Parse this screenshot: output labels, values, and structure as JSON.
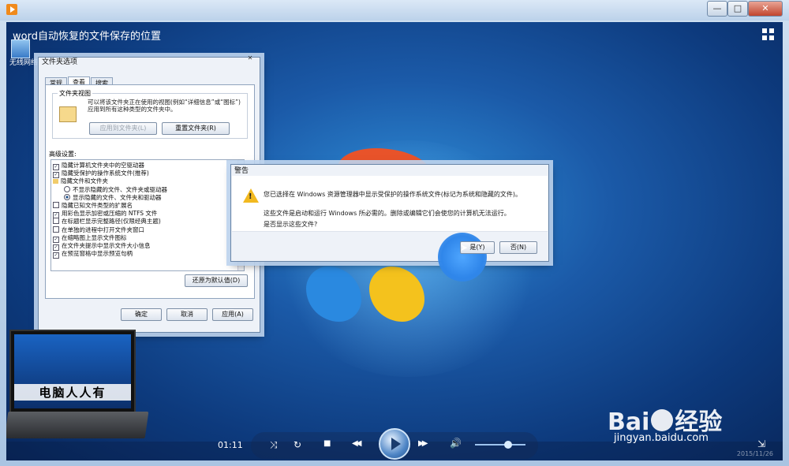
{
  "window": {
    "minimize": "—",
    "maximize": "□",
    "close": "✕"
  },
  "video": {
    "title": "word自动恢复的文件保存的位置",
    "desktop_icon_label": "无线网络"
  },
  "folder_options": {
    "title": "文件夹选项",
    "tabs": [
      "常规",
      "查看",
      "搜索"
    ],
    "folder_view_title": "文件夹视图",
    "folder_view_desc": "可以将该文件夹正在使用的视图(例如“详细信息”或“图标”)应用到所有这种类型的文件夹中。",
    "apply_to_folders": "应用到文件夹(L)",
    "reset_folders": "重置文件夹(R)",
    "advanced_label": "高级设置:",
    "advanced_items": [
      {
        "kind": "check",
        "checked": true,
        "text": "隐藏计算机文件夹中的空驱动器"
      },
      {
        "kind": "check",
        "checked": true,
        "text": "隐藏受保护的操作系统文件(推荐)"
      },
      {
        "kind": "folder",
        "text": "隐藏文件和文件夹"
      },
      {
        "kind": "radio",
        "checked": false,
        "text": "不显示隐藏的文件、文件夹或驱动器"
      },
      {
        "kind": "radio",
        "checked": true,
        "text": "显示隐藏的文件、文件夹和驱动器"
      },
      {
        "kind": "check",
        "checked": false,
        "text": "隐藏已知文件类型的扩展名"
      },
      {
        "kind": "check",
        "checked": true,
        "text": "用彩色显示加密或压缩的 NTFS 文件"
      },
      {
        "kind": "check",
        "checked": false,
        "text": "在标题栏显示完整路径(仅限经典主题)"
      },
      {
        "kind": "check",
        "checked": false,
        "text": "在单独的进程中打开文件夹窗口"
      },
      {
        "kind": "check",
        "checked": true,
        "text": "在缩略图上显示文件图标"
      },
      {
        "kind": "check",
        "checked": true,
        "text": "在文件夹提示中显示文件大小信息"
      },
      {
        "kind": "check",
        "checked": true,
        "text": "在预览窗格中显示预览句柄"
      }
    ],
    "restore_defaults": "还原为默认值(D)",
    "ok": "确定",
    "cancel": "取消",
    "apply": "应用(A)"
  },
  "warning": {
    "title": "警告",
    "line1": "您已选择在 Windows 资源管理器中显示受保护的操作系统文件(标记为系统和隐藏的文件)。",
    "line2": "这些文件是启动和运行 Windows 所必需的。删除或编辑它们会使您的计算机无法运行。",
    "line3": "是否显示这些文件?",
    "yes": "是(Y)",
    "no": "否(N)"
  },
  "laptop_text": "电脑人人有",
  "controls": {
    "time": "01:11",
    "shuffle_icon": "⤨",
    "repeat_icon": "↻",
    "stop_icon": "■",
    "prev_icon": "◀◀",
    "next_icon": "▶▶",
    "volume_icon": "🔊",
    "volume_level": 0.65
  },
  "watermark": {
    "brand_left": "Bai",
    "brand_right": "经验",
    "url": "jingyan.baidu.com"
  },
  "date_text": "2015/11/26"
}
